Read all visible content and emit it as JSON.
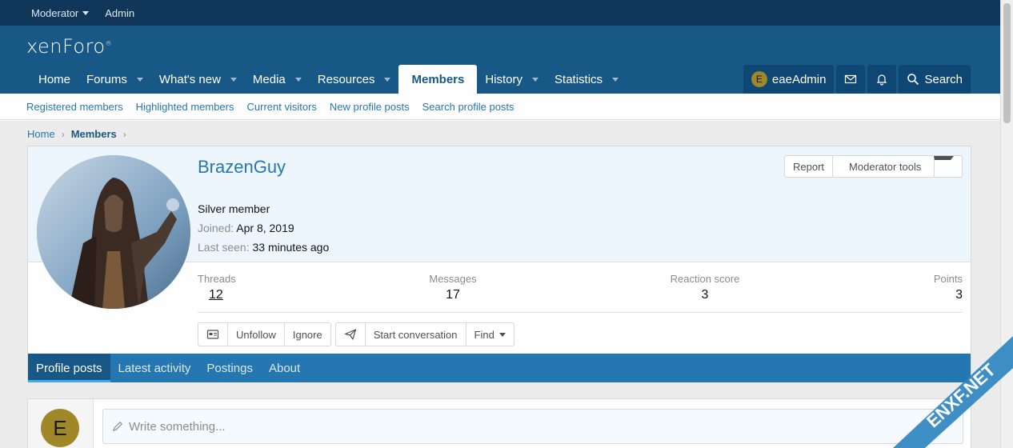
{
  "topbar": {
    "moderator": "Moderator",
    "admin": "Admin"
  },
  "logo": {
    "text": "xenForo"
  },
  "nav": {
    "tabs": [
      {
        "label": "Home"
      },
      {
        "label": "Forums"
      },
      {
        "label": "What's new"
      },
      {
        "label": "Media"
      },
      {
        "label": "Resources"
      },
      {
        "label": "Members"
      },
      {
        "label": "History"
      },
      {
        "label": "Statistics"
      }
    ],
    "user": {
      "initial": "E",
      "name": "eaeAdmin"
    },
    "search_label": "Search"
  },
  "subnav": {
    "items": [
      "Registered members",
      "Highlighted members",
      "Current visitors",
      "New profile posts",
      "Search profile posts"
    ]
  },
  "breadcrumb": {
    "home": "Home",
    "members": "Members"
  },
  "profile": {
    "username": "BrazenGuy",
    "title": "Silver member",
    "joined_label": "Joined:",
    "joined_value": "Apr 8, 2019",
    "lastseen_label": "Last seen:",
    "lastseen_value": "33 minutes ago",
    "report": "Report",
    "moderator_tools": "Moderator tools"
  },
  "stats": {
    "threads_label": "Threads",
    "threads_value": "12",
    "messages_label": "Messages",
    "messages_value": "17",
    "reaction_label": "Reaction score",
    "reaction_value": "3",
    "points_label": "Points",
    "points_value": "3"
  },
  "actions": {
    "unfollow": "Unfollow",
    "ignore": "Ignore",
    "start_conversation": "Start conversation",
    "find": "Find"
  },
  "tabs": [
    "Profile posts",
    "Latest activity",
    "Postings",
    "About"
  ],
  "post": {
    "initial": "E",
    "placeholder": "Write something..."
  },
  "watermark": {
    "text": "ENXF.NET"
  },
  "colors": {
    "topbar": "#10365a",
    "header": "#185886",
    "tabs": "#2577b1",
    "link": "#2577b1"
  }
}
